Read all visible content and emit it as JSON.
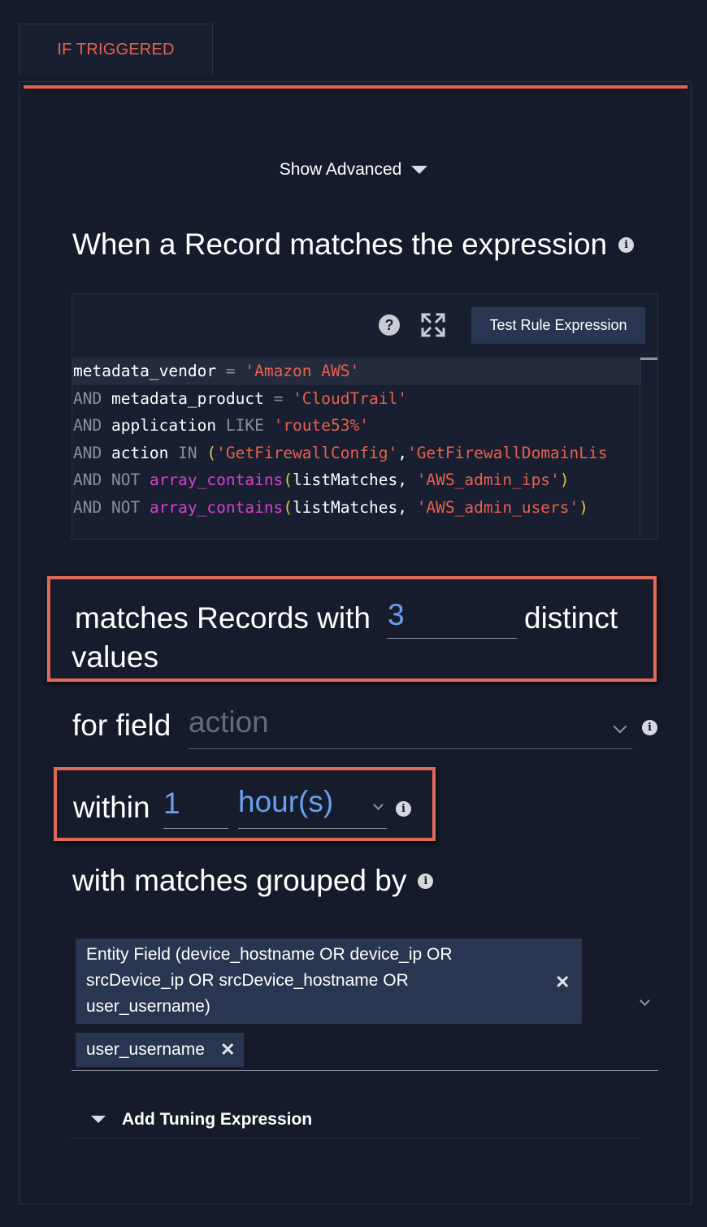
{
  "tab": {
    "label": "IF TRIGGERED"
  },
  "show_advanced": {
    "label": "Show Advanced"
  },
  "expression_section": {
    "title": "When a Record matches the expression"
  },
  "editor": {
    "test_button_label": "Test Rule Expression",
    "help_symbol": "?",
    "lines": [
      [
        {
          "c": "t",
          "v": "metadata_vendor "
        },
        {
          "c": "k",
          "v": "="
        },
        {
          "c": "t",
          "v": " "
        },
        {
          "c": "s",
          "v": "'Amazon AWS'"
        }
      ],
      [
        {
          "c": "k",
          "v": "AND"
        },
        {
          "c": "t",
          "v": " metadata_product "
        },
        {
          "c": "k",
          "v": "="
        },
        {
          "c": "t",
          "v": " "
        },
        {
          "c": "s",
          "v": "'CloudTrail'"
        }
      ],
      [
        {
          "c": "k",
          "v": "AND"
        },
        {
          "c": "t",
          "v": " application "
        },
        {
          "c": "k",
          "v": "LIKE"
        },
        {
          "c": "t",
          "v": " "
        },
        {
          "c": "s",
          "v": "'route53%'"
        }
      ],
      [
        {
          "c": "k",
          "v": "AND"
        },
        {
          "c": "t",
          "v": " action "
        },
        {
          "c": "k",
          "v": "IN"
        },
        {
          "c": "t",
          "v": " "
        },
        {
          "c": "p",
          "v": "("
        },
        {
          "c": "s",
          "v": "'GetFirewallConfig'"
        },
        {
          "c": "t",
          "v": ","
        },
        {
          "c": "s",
          "v": "'GetFirewallDomainLis"
        }
      ],
      [
        {
          "c": "k",
          "v": "AND NOT"
        },
        {
          "c": "t",
          "v": " "
        },
        {
          "c": "f",
          "v": "array_contains"
        },
        {
          "c": "p",
          "v": "("
        },
        {
          "c": "t",
          "v": "listMatches, "
        },
        {
          "c": "s",
          "v": "'AWS_admin_ips'"
        },
        {
          "c": "p",
          "v": ")"
        }
      ],
      [
        {
          "c": "k",
          "v": "AND NOT"
        },
        {
          "c": "t",
          "v": " "
        },
        {
          "c": "f",
          "v": "array_contains"
        },
        {
          "c": "p",
          "v": "("
        },
        {
          "c": "t",
          "v": "listMatches, "
        },
        {
          "c": "s",
          "v": "'AWS_admin_users'"
        },
        {
          "c": "p",
          "v": ")"
        }
      ]
    ]
  },
  "distinct": {
    "prefix": "matches Records with",
    "value": "3",
    "suffix": "distinct",
    "line2": "values"
  },
  "for_field": {
    "label": "for field",
    "value": "action"
  },
  "within": {
    "label": "within",
    "value": "1",
    "unit": "hour(s)"
  },
  "grouped": {
    "title": "with matches grouped by",
    "chips": [
      "Entity Field  (device_hostname OR device_ip OR srcDevice_ip OR srcDevice_hostname OR user_username)",
      "user_username"
    ],
    "remove_symbol": "✕"
  },
  "tuning": {
    "label": "Add Tuning Expression"
  },
  "colors": {
    "accent": "#e8604f",
    "link": "#6a9ff0",
    "background": "#151b2a",
    "chip": "#2a3552"
  }
}
